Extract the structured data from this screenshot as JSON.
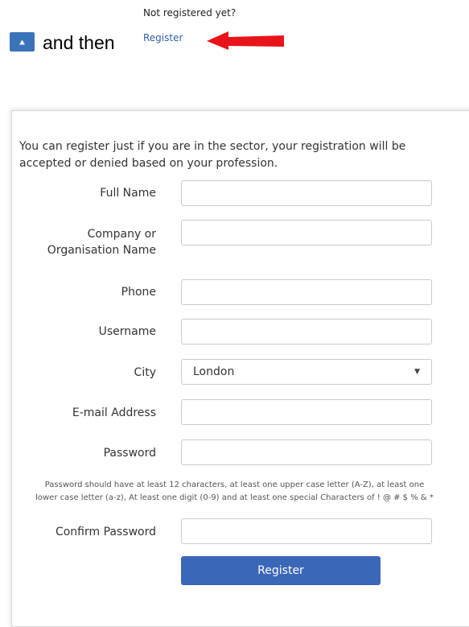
{
  "top": {
    "not_registered": "Not registered yet?",
    "and_then": "and then",
    "register_link": "Register",
    "accent_color": "#3b73b9",
    "arrow_color": "#e8141a",
    "user_icon": "user-icon",
    "arrow_icon": "arrow-left-icon"
  },
  "form": {
    "intro": "You can register just if you are in the sector, your registration will be accepted or denied based on your profession.",
    "full_name_label": "Full Name",
    "company_label_1": "Company or",
    "company_label_2": "Organisation Name",
    "phone_label": "Phone",
    "username_label": "Username",
    "city_label": "City",
    "city_value": "London",
    "email_label": "E-mail Address",
    "password_label": "Password",
    "password_hint_1": "Password should have at least 12 characters, at least one upper case letter (A-Z), at least one",
    "password_hint_2": "lower case letter (a-z), At least one digit (0-9) and at least one special Characters of ! @ # $ % & *",
    "confirm_password_label": "Confirm Password",
    "submit_label": "Register",
    "button_color": "#3b67b8"
  }
}
